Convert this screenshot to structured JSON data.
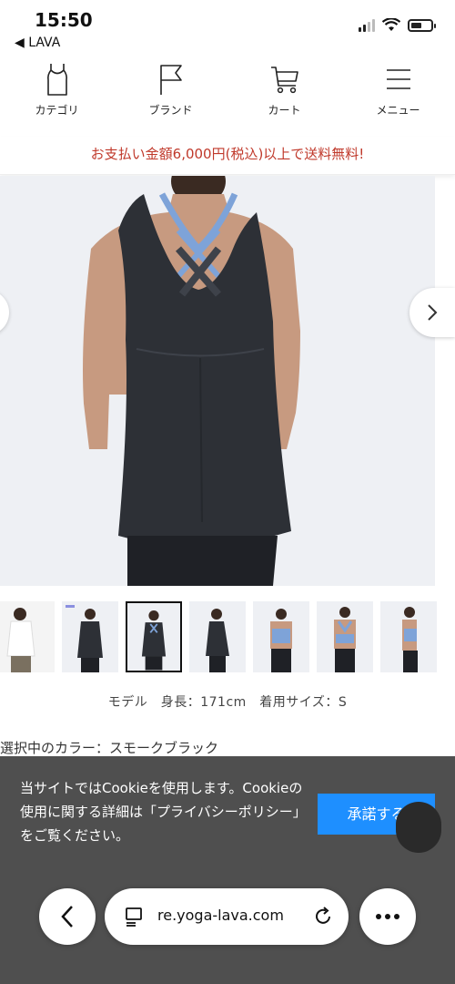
{
  "status_bar": {
    "time": "15:50",
    "back_app": "◀ LAVA"
  },
  "nav": [
    {
      "label": "カテゴリ",
      "icon": "tank-top-icon"
    },
    {
      "label": "ブランド",
      "icon": "flag-icon"
    },
    {
      "label": "カート",
      "icon": "cart-icon"
    },
    {
      "label": "メニュー",
      "icon": "menu-icon"
    }
  ],
  "promo": "お支払い金額6,000円(税込)以上で送料無料!",
  "product": {
    "model_info": "モデル　身長：171cm　着用サイズ：S",
    "color_label": "選択中のカラー：スモークブラック"
  },
  "cookie": {
    "text": "当サイトではCookieを使用します。Cookieの使用に関する詳細は「プライバシーポリシー」をご覧ください。",
    "accept_label": "承諾する"
  },
  "browser": {
    "url": "re.yoga-lava.com"
  },
  "colors": {
    "promo_red": "#c0392b",
    "accept_blue": "#1e8fff",
    "banner_grey": "#464646"
  }
}
